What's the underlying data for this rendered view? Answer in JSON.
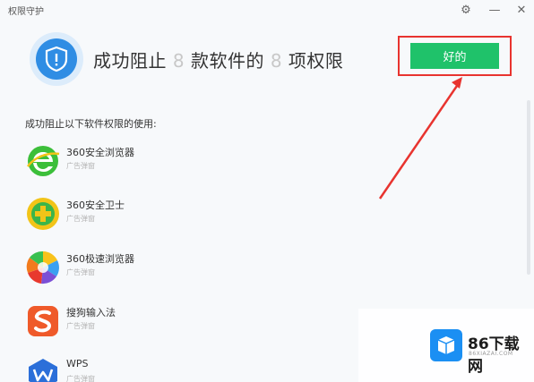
{
  "window": {
    "title": "权限守护"
  },
  "header": {
    "text_prefix": "成功阻止",
    "app_count": "8",
    "text_middle": "款软件的",
    "perm_count": "8",
    "text_suffix": "项权限",
    "ok_label": "好的"
  },
  "list": {
    "title": "成功阻止以下软件权限的使用:",
    "items": [
      {
        "name": "360安全浏览器",
        "sub": "广告弹窗",
        "icon": "360-browser-icon"
      },
      {
        "name": "360安全卫士",
        "sub": "广告弹窗",
        "icon": "360-security-icon"
      },
      {
        "name": "360极速浏览器",
        "sub": "广告弹窗",
        "icon": "360-speed-browser-icon"
      },
      {
        "name": "搜狗输入法",
        "sub": "广告弹窗",
        "icon": "sogou-input-icon"
      },
      {
        "name": "WPS",
        "sub": "广告弹窗",
        "icon": "wps-icon"
      }
    ]
  },
  "watermark": {
    "text": "86下载网",
    "sub": "86XIAZAI.COM"
  },
  "colors": {
    "accent_green": "#1fc26a",
    "annotation_red": "#e8342f",
    "shield_blue": "#2f8de4"
  }
}
